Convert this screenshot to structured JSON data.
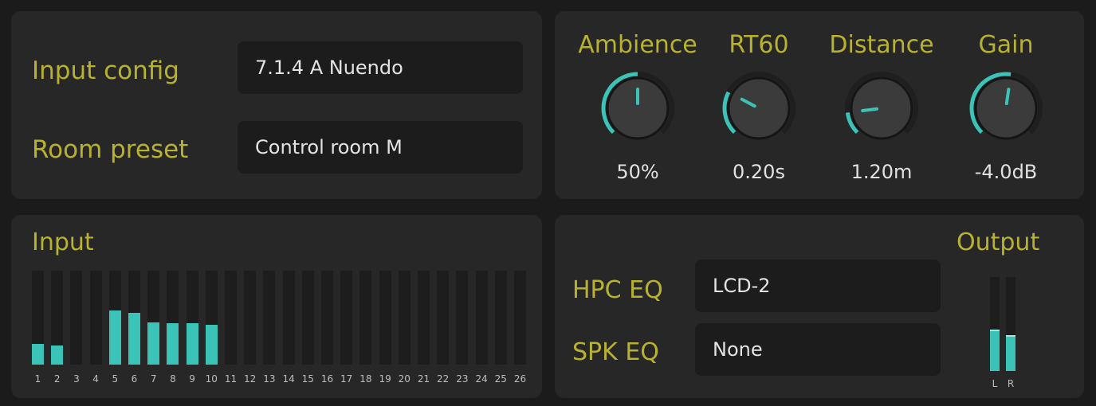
{
  "config": {
    "input_config_label": "Input config",
    "input_config_value": "7.1.4 A Nuendo",
    "room_preset_label": "Room preset",
    "room_preset_value": "Control room M"
  },
  "knobs": [
    {
      "label": "Ambience",
      "value_text": "50%",
      "fraction": 0.5
    },
    {
      "label": "RT60",
      "value_text": "0.20s",
      "fraction": 0.27
    },
    {
      "label": "Distance",
      "value_text": "1.20m",
      "fraction": 0.14
    },
    {
      "label": "Gain",
      "value_text": "-4.0dB",
      "fraction": 0.53
    }
  ],
  "input": {
    "title": "Input",
    "channels": [
      "1",
      "2",
      "3",
      "4",
      "5",
      "6",
      "7",
      "8",
      "9",
      "10",
      "11",
      "12",
      "13",
      "14",
      "15",
      "16",
      "17",
      "18",
      "19",
      "20",
      "21",
      "22",
      "23",
      "24",
      "25",
      "26"
    ],
    "levels": [
      0.22,
      0.2,
      0,
      0,
      0.58,
      0.55,
      0.45,
      0.44,
      0.44,
      0.42,
      0,
      0,
      0,
      0,
      0,
      0,
      0,
      0,
      0,
      0,
      0,
      0,
      0,
      0,
      0,
      0
    ]
  },
  "eq": {
    "hpc_label": "HPC EQ",
    "hpc_value": "LCD-2",
    "spk_label": "SPK EQ",
    "spk_value": "None"
  },
  "output": {
    "title": "Output",
    "channels": [
      "L",
      "R"
    ],
    "levels": [
      0.44,
      0.38
    ]
  },
  "colors": {
    "accent": "#3cc3b7",
    "label_gold": "#b8b230",
    "panel_bg": "#272727",
    "field_bg": "#1c1c1c"
  }
}
